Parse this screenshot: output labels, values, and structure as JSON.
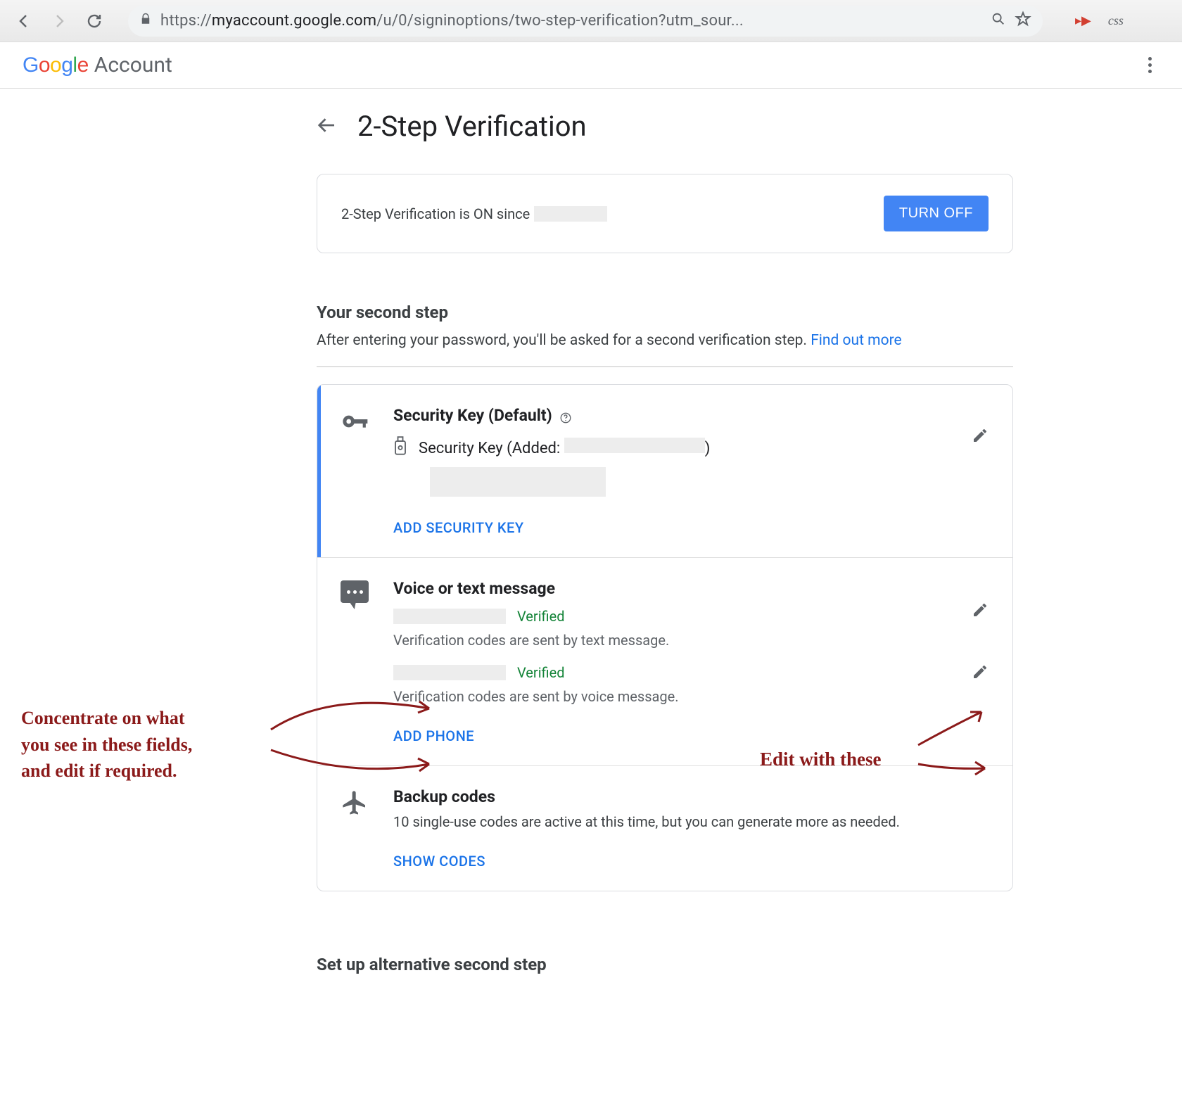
{
  "chrome": {
    "url_prefix": "https://",
    "url_host": "myaccount.google.com",
    "url_path": "/u/0/signinoptions/two-step-verification?utm_sour...",
    "css_ext": "css"
  },
  "header": {
    "logo_letters": [
      "G",
      "o",
      "o",
      "g",
      "l",
      "e"
    ],
    "account_word": "Account"
  },
  "page": {
    "title": "2-Step Verification",
    "status_prefix": "2-Step Verification is ON since",
    "turn_off": "TURN OFF",
    "second_step_heading": "Your second step",
    "second_step_body": "After entering your password, you'll be asked for a second verification step. ",
    "find_out_more": "Find out more",
    "alt_heading": "Set up alternative second step"
  },
  "methods": {
    "security_key": {
      "title": "Security Key (Default)",
      "entry_prefix": "Security Key (Added: ",
      "entry_suffix": ")",
      "add_label": "ADD SECURITY KEY"
    },
    "voice": {
      "title": "Voice or text message",
      "verified1": "Verified",
      "desc1": "Verification codes are sent by text message.",
      "verified2": "Verified",
      "desc2": "Verification codes are sent by voice message.",
      "add_label": "ADD PHONE"
    },
    "backup": {
      "title": "Backup codes",
      "desc": "10 single-use codes are active at this time, but you can generate more as needed.",
      "show_label": "SHOW CODES"
    }
  },
  "annotations": {
    "left_l1": "Concentrate on what",
    "left_l2": "you see in these fields,",
    "left_l3": "and edit if required.",
    "right": "Edit with these"
  }
}
